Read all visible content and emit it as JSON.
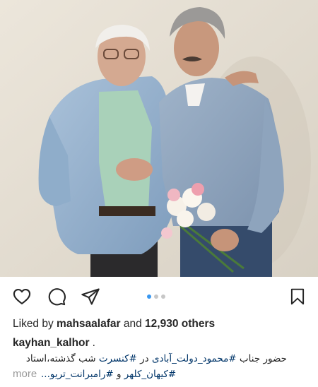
{
  "post": {
    "likes": {
      "prefix": "Liked by",
      "user": "mahsaalafar",
      "connector": "and",
      "count": "12,930 others"
    },
    "caption": {
      "username": "kayhan_kalhor",
      "trail": ".",
      "line1_plain_start": "حضور جناب",
      "line1_tag1": "#محمود_دولت_آبادی",
      "line1_mid": "در",
      "line1_tag2": "#کنسرت",
      "line1_end": "شب گذشته،استاد",
      "line2_tag1": "#کیهان_کلهر",
      "line2_mid": "و",
      "line2_tag2": "#رامبرانت_تریو...",
      "more": "more"
    },
    "carousel": {
      "count": 3,
      "active": 0
    }
  },
  "icons": {
    "like": "heart-icon",
    "comment": "comment-icon",
    "share": "paper-plane-icon",
    "save": "bookmark-icon"
  },
  "colors": {
    "accent": "#3897f0",
    "hashtag": "#003569",
    "text": "#262626",
    "muted": "#999999"
  }
}
